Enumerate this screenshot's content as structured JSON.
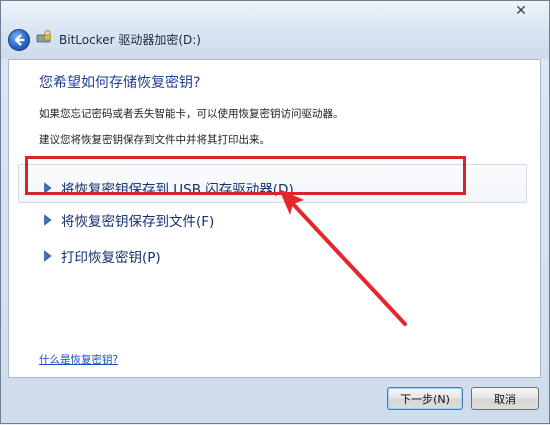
{
  "window": {
    "title": "BitLocker 驱动器加密(D:)",
    "close_glyph": "✕"
  },
  "content": {
    "heading": "您希望如何存储恢复密钥?",
    "desc1": "如果您忘记密码或者丢失智能卡，可以使用恢复密钥访问驱动器。",
    "desc2": "建议您将恢复密钥保存到文件中并将其打印出来。",
    "options": [
      {
        "label": "将恢复密钥保存到 USB 闪存驱动器(D)",
        "icon": "arrow-right-icon"
      },
      {
        "label": "将恢复密钥保存到文件(F)",
        "icon": "arrow-right-icon"
      },
      {
        "label": "打印恢复密钥(P)",
        "icon": "arrow-right-icon"
      }
    ],
    "help_link": "什么是恢复密钥?"
  },
  "buttons": {
    "next": "下一步(N)",
    "cancel": "取消"
  },
  "colors": {
    "heading": "#1f3e96",
    "link": "#1b4ec0",
    "annotation": "#d6262b"
  }
}
